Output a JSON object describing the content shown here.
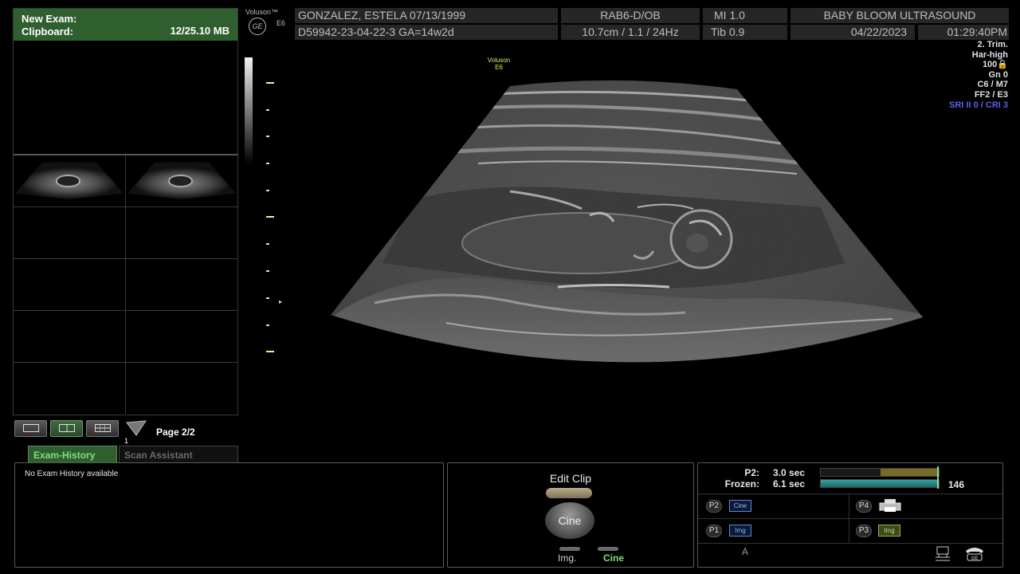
{
  "clipboard": {
    "title": "New Exam:",
    "subtitle": "Clipboard:",
    "size": "12/25.10 MB"
  },
  "page": {
    "label": "Page 2/2",
    "marker": "1"
  },
  "tabs": [
    {
      "label": "Exam-History",
      "active": true
    },
    {
      "label": "Scan Assistant",
      "active": false
    }
  ],
  "history": {
    "text": "No Exam History available"
  },
  "cine": {
    "title": "Edit Clip",
    "knob_label": "Cine",
    "img_label": "Img.",
    "cine_label": "Cine"
  },
  "status": {
    "p2_label": "P2:",
    "p2_value": "3.0 sec",
    "frozen_label": "Frozen:",
    "frozen_value": "6.1 sec",
    "frozen_count": "146",
    "p2_fill_fraction": 0.49,
    "frozen_fill_fraction": 1.0,
    "buttons": [
      {
        "badge": "P2",
        "icon": "Cine",
        "icon_name": "cine-icon"
      },
      {
        "badge": "P4",
        "icon": "",
        "icon_name": "printer-icon"
      },
      {
        "badge": "P1",
        "icon": "Img",
        "icon_name": "image-icon"
      },
      {
        "badge": "P3",
        "icon": "Img",
        "icon_name": "mail-icon"
      }
    ],
    "a_label": "A"
  },
  "header": {
    "brand": "Voluson™",
    "model": "E6",
    "ge": "GE",
    "patient": "GONZALEZ, ESTELA  07/13/1999",
    "probe": "RAB6-D/OB",
    "mi": "MI  1.0",
    "clinic": "BABY BLOOM ULTRASOUND",
    "exam_id": "D59942-23-04-22-3  GA=14w2d",
    "depth": "10.7cm / 1.1 / 24Hz",
    "tib": "Tib  0.9",
    "date": "04/22/2023",
    "time": "01:29:40PM"
  },
  "right_info": {
    "trim": "2. Trim.",
    "har": "Har-high",
    "power": "100🔒",
    "gn": "Gn   0",
    "c": "C6 / M7",
    "ff": "FF2 / E3",
    "sri": "SRI II 0 / CRI 3"
  },
  "overlay": {
    "brand": "Voluson",
    "model": "E6"
  },
  "colors": {
    "accent_green": "#2f5e2f",
    "active_text": "#7fe07f",
    "sri_blue": "#6060e8"
  }
}
